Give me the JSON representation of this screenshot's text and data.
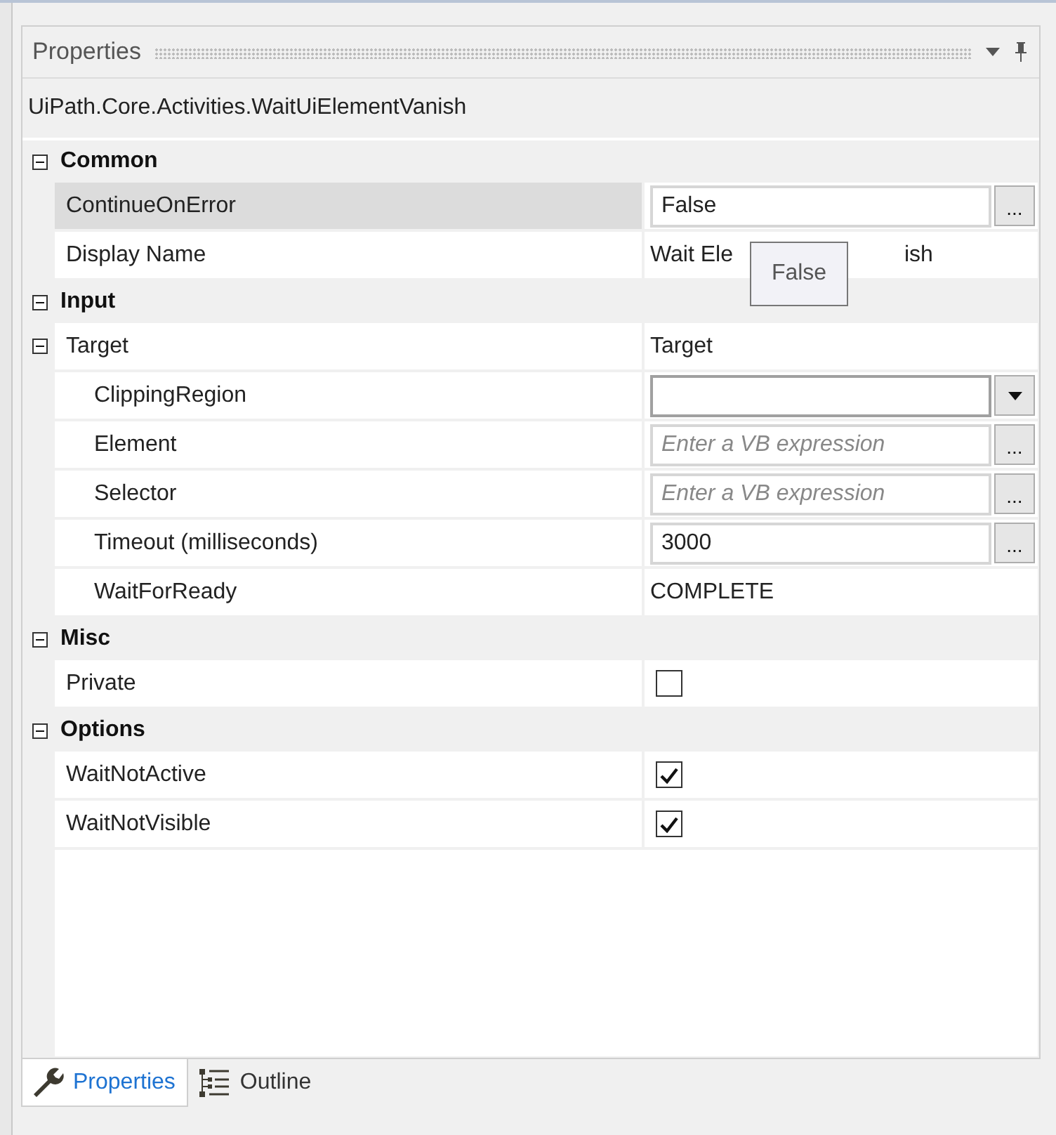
{
  "panel": {
    "title": "Properties",
    "activity": "UiPath.Core.Activities.WaitUiElementVanish"
  },
  "categories": [
    {
      "name": "Common",
      "expanded": true,
      "properties": [
        {
          "name": "ContinueOnError",
          "kind": "field",
          "value": "False",
          "button": "...",
          "selected": true
        },
        {
          "name": "Display Name",
          "kind": "covered",
          "value_parts": [
            "Wait Ele",
            "ish"
          ],
          "selected": false
        }
      ]
    },
    {
      "name": "Input",
      "expanded": true,
      "properties": [
        {
          "name": "Target",
          "kind": "group",
          "value": "Target",
          "expanded": true,
          "selected": false,
          "children": [
            {
              "name": "ClippingRegion",
              "kind": "dropdown",
              "selected": false
            },
            {
              "name": "Element",
              "kind": "field",
              "placeholder": "Enter a VB expression",
              "button": "...",
              "selected": false
            },
            {
              "name": "Selector",
              "kind": "field",
              "placeholder": "Enter a VB expression",
              "button": "...",
              "selected": false
            },
            {
              "name": "Timeout (milliseconds)",
              "kind": "field",
              "value": "3000",
              "button": "...",
              "selected": false
            },
            {
              "name": "WaitForReady",
              "kind": "text",
              "value": "COMPLETE",
              "selected": false
            }
          ]
        }
      ]
    },
    {
      "name": "Misc",
      "expanded": true,
      "properties": [
        {
          "name": "Private",
          "kind": "checkbox",
          "checked": false,
          "selected": false
        }
      ]
    },
    {
      "name": "Options",
      "expanded": true,
      "properties": [
        {
          "name": "WaitNotActive",
          "kind": "checkbox",
          "checked": true,
          "selected": false
        },
        {
          "name": "WaitNotVisible",
          "kind": "checkbox",
          "checked": true,
          "selected": false
        }
      ]
    }
  ],
  "tooltip": {
    "text": "False"
  },
  "tabs": [
    {
      "label": "Properties",
      "selected": true
    },
    {
      "label": "Outline",
      "selected": false
    }
  ]
}
